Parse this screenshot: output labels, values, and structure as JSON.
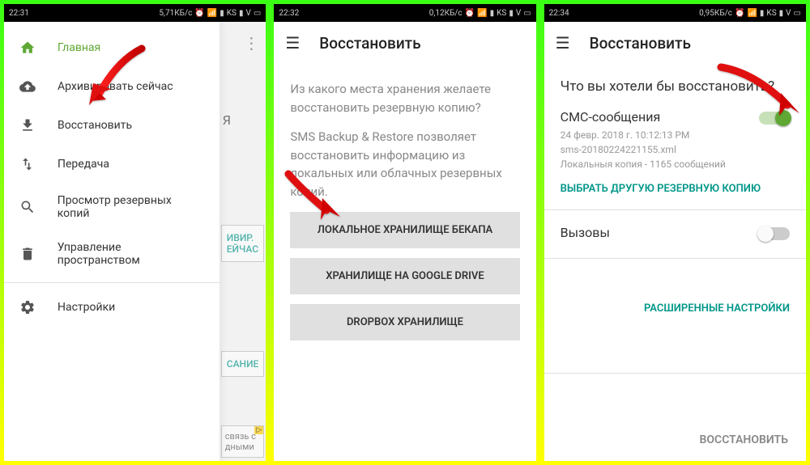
{
  "screen1": {
    "status": {
      "time": "22:31",
      "speed": "5,71КБ/с",
      "carrier": "KS",
      "v": "V"
    },
    "drawer": {
      "items": [
        {
          "label": "Главная",
          "icon": "home",
          "active": true
        },
        {
          "label": "Архивировать сейчас",
          "icon": "cloud-upload"
        },
        {
          "label": "Восстановить",
          "icon": "download"
        },
        {
          "label": "Передача",
          "icon": "transfer"
        },
        {
          "label": "Просмотр резервных копий",
          "icon": "search"
        },
        {
          "label": "Управление пространством",
          "icon": "trash"
        },
        {
          "label": "Настройки",
          "icon": "gear"
        }
      ]
    },
    "backdrop": {
      "partial1": "Я",
      "card1_a": "ИВИР.",
      "card1_b": "ЕЙЧАС",
      "card2": "САНИЕ",
      "ad_a": "связь с",
      "ad_b": "дными"
    }
  },
  "screen2": {
    "status": {
      "time": "22:32",
      "speed": "0,12КБ/с",
      "carrier": "KS",
      "v": "V"
    },
    "title": "Восстановить",
    "prompt1": "Из какого места хранения желаете восстановить резервную копию?",
    "prompt2": "SMS Backup & Restore позволяет восстановить информацию из локальных или облачных резервных копий.",
    "options": [
      "ЛОКАЛЬНОЕ ХРАНИЛИЩЕ БЕКАПА",
      "ХРАНИЛИЩЕ НА GOOGLE DRIVE",
      "DROPBOX ХРАНИЛИЩЕ"
    ]
  },
  "screen3": {
    "status": {
      "time": "22:34",
      "speed": "0,95КБ/с",
      "carrier": "KS",
      "v": "V"
    },
    "title": "Восстановить",
    "question": "Что вы хотели бы восстановить?",
    "sms": {
      "title": "СМС-сообщения",
      "date": "24 февр. 2018 г. 10:12:13 PM",
      "file": "sms-20180224221155.xml",
      "info": "Локальныя копия - 1165 сообщений",
      "choose": "ВЫБРАТЬ ДРУГУЮ РЕЗЕРВНУЮ КОПИЮ"
    },
    "calls": {
      "title": "Вызовы"
    },
    "advanced": "РАСШИРЕННЫЕ НАСТРОЙКИ",
    "restore_btn": "ВОССТАНОВИТЬ"
  }
}
